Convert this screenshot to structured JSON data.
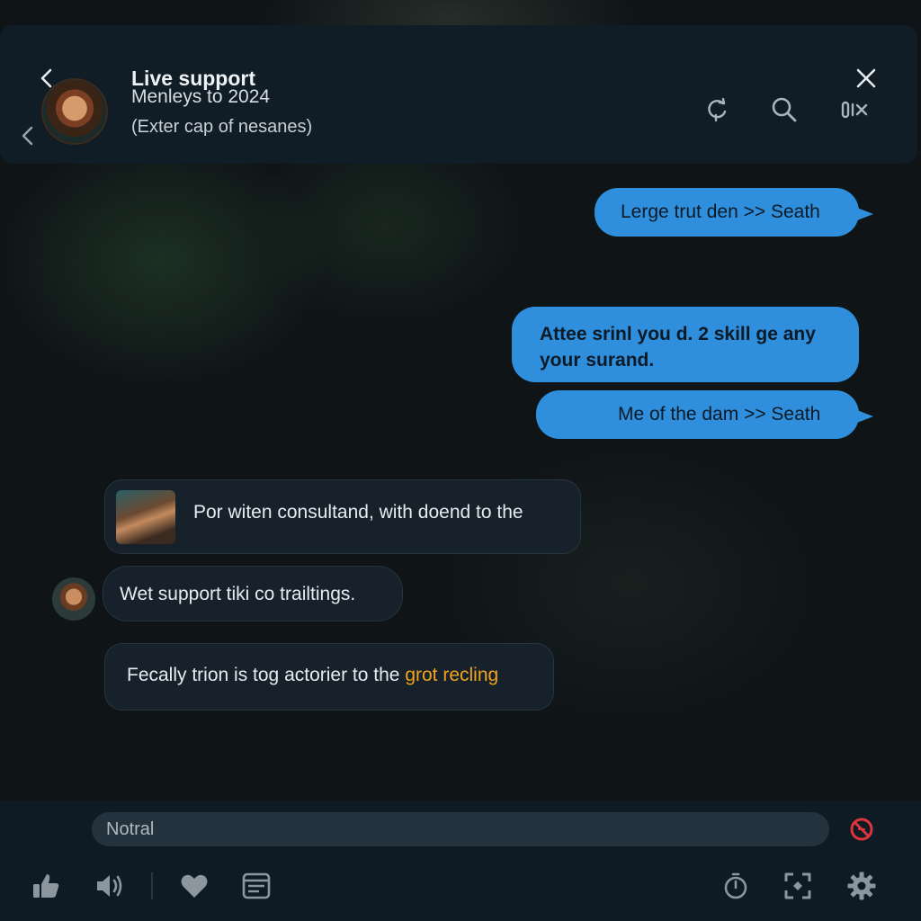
{
  "header": {
    "title": "Live support",
    "contact_line1": "Menleys to 2024",
    "contact_line2": "(Exter cap of nesanes)"
  },
  "messages": {
    "out1": "Lerge trut den >> Seath",
    "out2_line1": "Attee srinl you d. 2 skill ge any",
    "out2_line2": "your surand.",
    "out3": "Me of the dam >> Seath",
    "in1": "Por witen consultand, with doend to the",
    "in2": "Wet support tiki co trailtings.",
    "in3_text": "Fecally trion is tog actorier to the ",
    "in3_highlight": "grot recling"
  },
  "composer": {
    "placeholder": "Notral"
  },
  "icons": {
    "header": [
      "back-icon",
      "close-icon",
      "prev-icon",
      "refresh-icon",
      "search-icon",
      "mute-icon"
    ],
    "toolbar": [
      "thumbs-up-icon",
      "speaker-icon",
      "heart-icon",
      "notes-icon",
      "timer-icon",
      "expand-icon",
      "gear-icon"
    ],
    "composer": "stop-icon"
  },
  "colors": {
    "accent": "#2f8fdc",
    "highlight": "#f2a31e",
    "stop": "#e0343c"
  }
}
